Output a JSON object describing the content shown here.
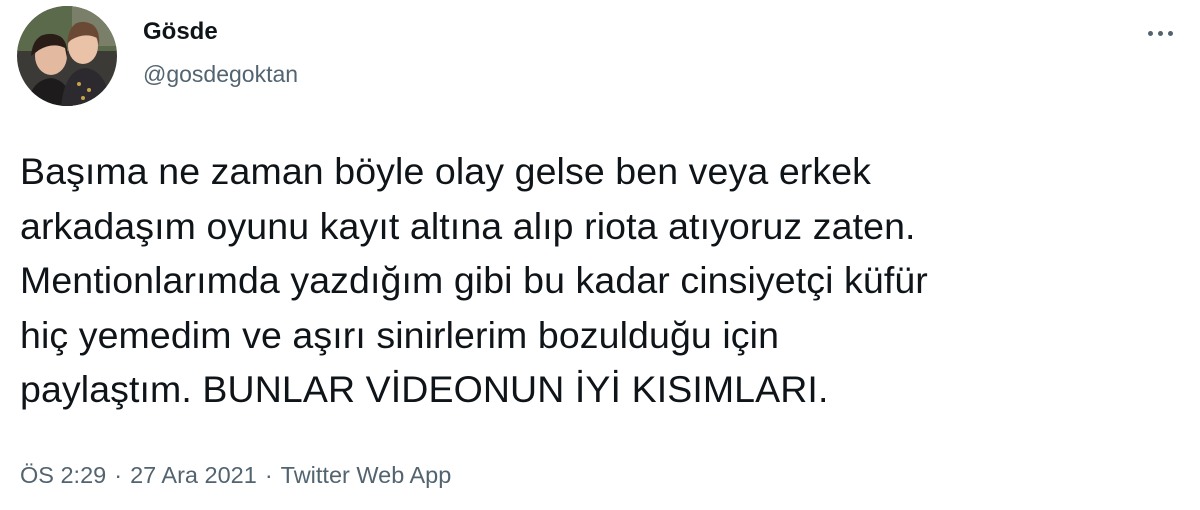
{
  "author": {
    "display_name": "Gösde",
    "handle": "@gosdegoktan"
  },
  "tweet": {
    "text": "Başıma ne zaman böyle olay gelse ben veya erkek\narkadaşım oyunu kayıt altına alıp riota atıyoruz zaten.\nMentionlarımda yazdığım gibi bu kadar cinsiyetçi küfür\nhiç yemedim ve aşırı sinirlerim bozulduğu için\npaylaştım. BUNLAR VİDEONUN İYİ KISIMLARI."
  },
  "meta": {
    "time": "ÖS 2:29",
    "date": "27 Ara 2021",
    "source": "Twitter Web App",
    "separator": "·"
  },
  "icons": {
    "more": "more-horizontal-icon"
  },
  "colors": {
    "text_primary": "#0f1419",
    "text_secondary": "#536471",
    "background": "#ffffff"
  }
}
